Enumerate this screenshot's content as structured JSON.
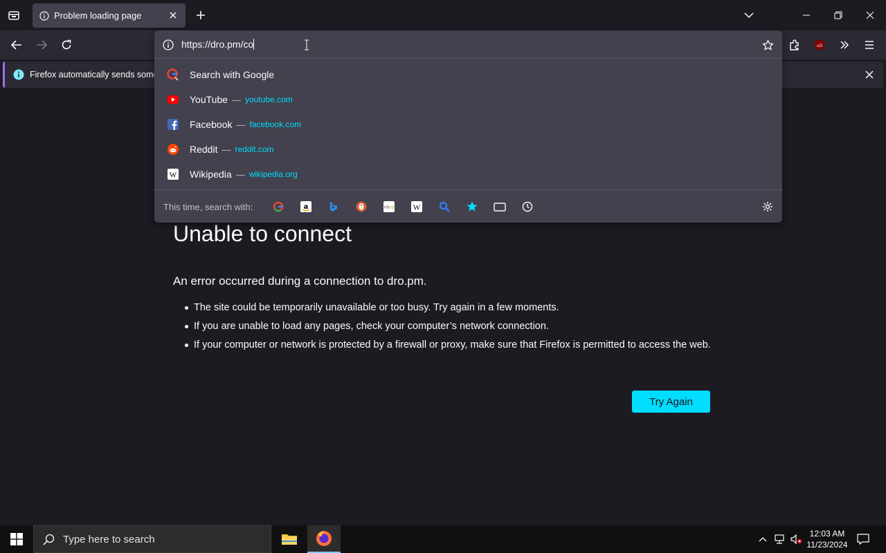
{
  "tab": {
    "title": "Problem loading page"
  },
  "address": {
    "value": "https://dro.pm/co"
  },
  "notification": {
    "text": "Firefox automatically sends some d"
  },
  "suggestions": [
    {
      "name": "Search with Google",
      "url": ""
    },
    {
      "name": "YouTube",
      "url": "youtube.com"
    },
    {
      "name": "Facebook",
      "url": "facebook.com"
    },
    {
      "name": "Reddit",
      "url": "reddit.com"
    },
    {
      "name": "Wikipedia",
      "url": "wikipedia.org"
    }
  ],
  "search_with": {
    "label": "This time, search with:",
    "engines": [
      "google",
      "amazon",
      "bing",
      "duckduckgo",
      "ebay",
      "wikipedia",
      "search",
      "bookmarks",
      "tabs",
      "history"
    ]
  },
  "error": {
    "title": "Unable to connect",
    "description": "An error occurred during a connection to dro.pm.",
    "bullets": [
      "The site could be temporarily unavailable or too busy. Try again in a few moments.",
      "If you are unable to load any pages, check your computer’s network connection.",
      "If your computer or network is protected by a firewall or proxy, make sure that Firefox is permitted to access the web."
    ],
    "button": "Try Again"
  },
  "taskbar": {
    "search_placeholder": "Type here to search",
    "time": "12:03 AM",
    "date": "11/23/2024"
  },
  "colors": {
    "accent": "#00ddff",
    "page_bg": "#1c1b22",
    "panel_bg": "#42414d",
    "toolbar_bg": "#2b2a33"
  }
}
